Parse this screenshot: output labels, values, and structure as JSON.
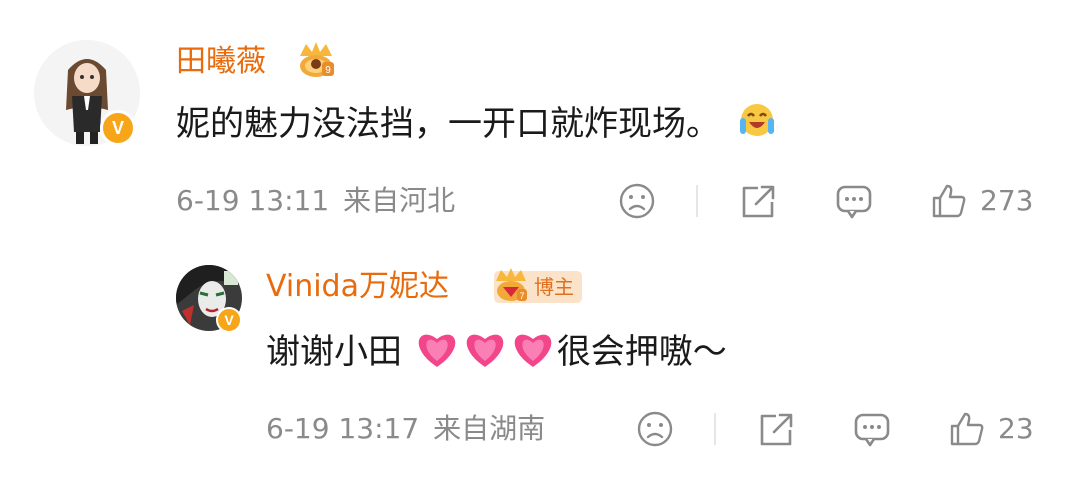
{
  "comments": [
    {
      "username": "田曦薇",
      "content": "妮的魅力没法挡，一开口就炸现场。",
      "emoji": "laughing-crying-emoji",
      "time": "6-19 13:11",
      "location": "来自河北",
      "likes": "273",
      "crown_level": "9",
      "verified_mark": "V"
    },
    {
      "username": "Vinida万妮达",
      "content_text": "谢谢小田",
      "content_tail": "很会押嗷～",
      "emoji": "pink-heart-emoji",
      "emoji_count": 3,
      "blogger_tag": "博主",
      "crown_level": "7",
      "time": "6-19 13:17",
      "location": "来自湖南",
      "likes": "23",
      "verified_mark": "V"
    }
  ],
  "icons": {
    "dislike": "sad-face-icon",
    "share": "share-icon",
    "comment": "comment-icon",
    "like": "thumbs-up-icon"
  },
  "colors": {
    "username": "#e86b0e",
    "meta": "#8a8a8a",
    "verify": "#f7a619",
    "heart": "#f2458a"
  }
}
